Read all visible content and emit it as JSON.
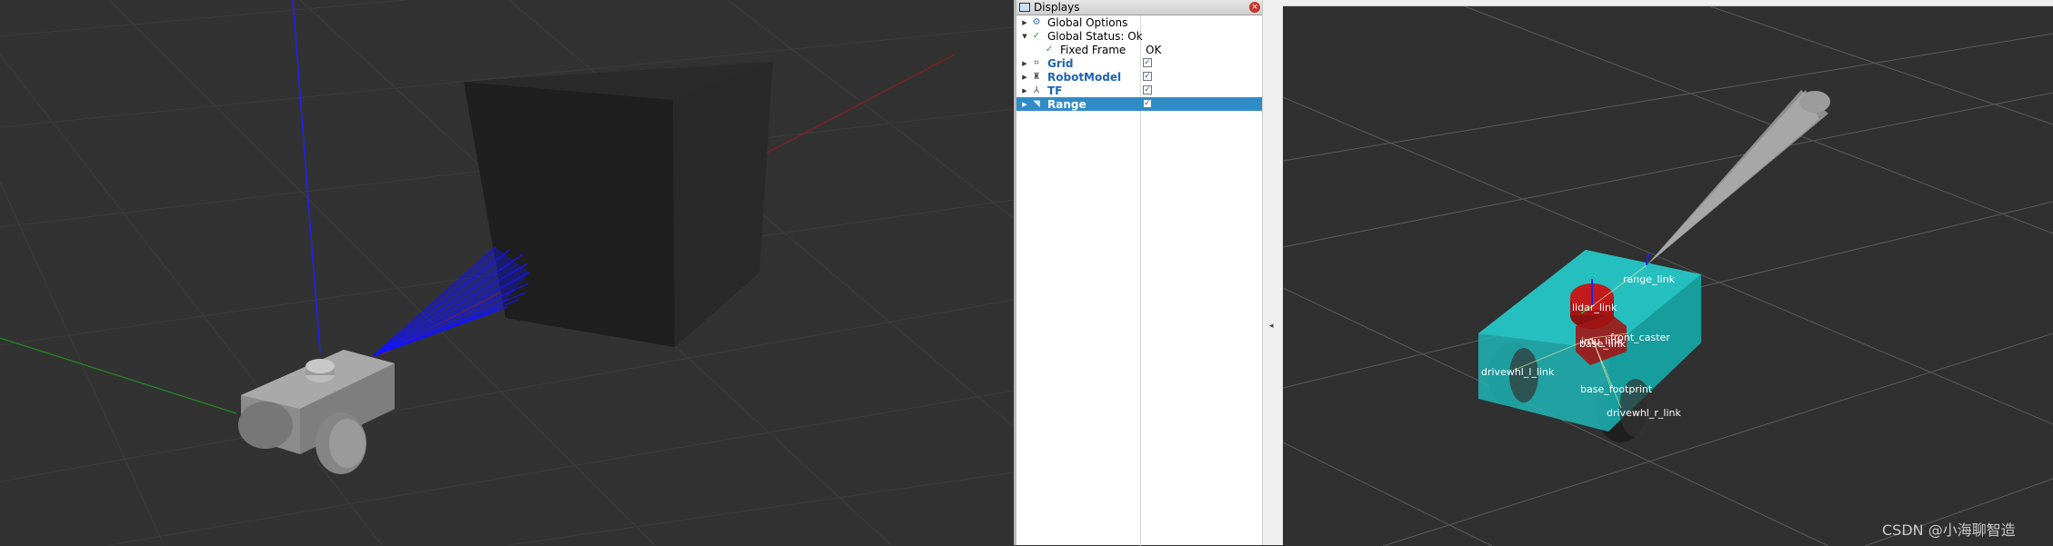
{
  "displays": {
    "title": "Displays",
    "close_glyph": "×",
    "items": [
      {
        "label": "Global Options",
        "icon": "gear-icon",
        "expand": "closed"
      },
      {
        "label": "Global Status: Ok",
        "icon": "check-icon",
        "expand": "open"
      },
      {
        "label": "Fixed Frame",
        "value": "OK",
        "icon": "check-icon",
        "expand": "none"
      },
      {
        "label": "Grid",
        "icon": "grid-icon",
        "expand": "closed",
        "checked": true
      },
      {
        "label": "RobotModel",
        "icon": "robot-icon",
        "expand": "closed",
        "checked": true
      },
      {
        "label": "TF",
        "icon": "axes-icon",
        "expand": "closed",
        "checked": true
      },
      {
        "label": "Range",
        "icon": "range-icon",
        "expand": "closed",
        "checked": true,
        "selected": true
      }
    ]
  },
  "rviz": {
    "frame_labels": [
      "range_link",
      "lidar_link",
      "imu_link",
      "base_link",
      "front_caster",
      "drivewhl_l_link",
      "base_footprint",
      "drivewhl_r_link"
    ]
  },
  "colors": {
    "selection": "#308cc6",
    "robot_body": "#1fb5b5",
    "lidar": "#a31515",
    "laser_rays": "#1414ff"
  },
  "watermark": "CSDN @小海聊智造"
}
